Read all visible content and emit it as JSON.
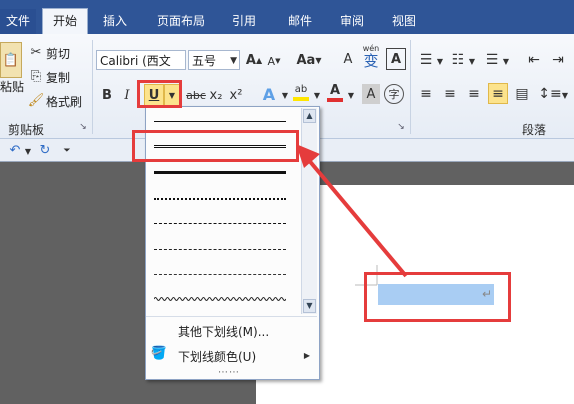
{
  "tabs": [
    {
      "label": "文件"
    },
    {
      "label": "开始"
    },
    {
      "label": "插入"
    },
    {
      "label": "页面布局"
    },
    {
      "label": "引用"
    },
    {
      "label": "邮件"
    },
    {
      "label": "审阅"
    },
    {
      "label": "视图"
    }
  ],
  "clipboard": {
    "paste": "粘贴",
    "cut": "剪切",
    "copy": "复制",
    "format_painter": "格式刷",
    "group_label": "剪贴板"
  },
  "font": {
    "name": "Calibri (西文",
    "size": "五号",
    "bold": "B",
    "italic": "I",
    "underline": "U",
    "strike": "abc",
    "subscript": "x₂",
    "superscript": "x²",
    "case": "Aa",
    "grow": "A",
    "shrink": "A",
    "clear": "A",
    "effect": "A",
    "highlight": "ab",
    "color": "A",
    "char_shade": "A",
    "phonetic": "wén",
    "enclose": "字"
  },
  "paragraph": {
    "group_label": "段落"
  },
  "underline_menu": {
    "more": "其他下划线(M)...",
    "color": "下划线颜色(U)"
  },
  "document": {
    "pilcrow": "↵"
  },
  "colors": {
    "ribbon_blue": "#2f5597",
    "annotation_red": "#e53c3c",
    "selection": "#a9cdf3",
    "highlight_yellow": "#ffe600",
    "font_red": "#e03030"
  }
}
